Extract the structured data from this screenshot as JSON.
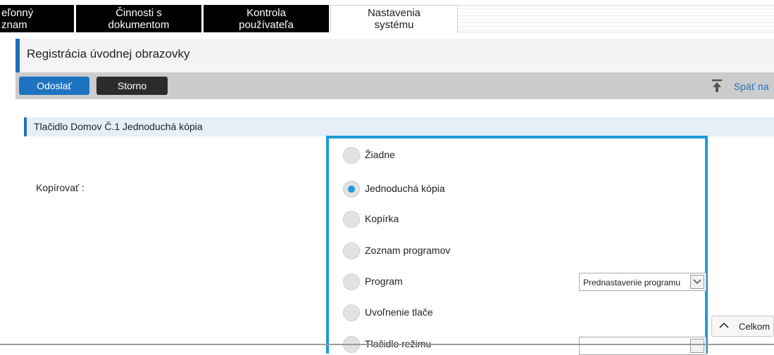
{
  "tabs": [
    {
      "line1": "eľonný",
      "line2": "znam"
    },
    {
      "line1": "Činnosti s",
      "line2": "dokumentom"
    },
    {
      "line1": "Kontrola",
      "line2": "používateľa"
    },
    {
      "line1": "Nastavenia",
      "line2": "systému"
    }
  ],
  "page": {
    "title": "Registrácia úvodnej obrazovky"
  },
  "toolbar": {
    "send_label": "Odoslať",
    "cancel_label": "Storno",
    "back_label": "Späť na"
  },
  "section": {
    "title": "Tlačidlo Domov Č.1 Jednoduchá kópia"
  },
  "form": {
    "copy_label": "Kopírovať :",
    "options": [
      {
        "label": "Žiadne",
        "selected": false
      },
      {
        "label": "Jednoduchá kópia",
        "selected": true
      },
      {
        "label": "Kopírka",
        "selected": false
      },
      {
        "label": "Zoznam programov",
        "selected": false
      },
      {
        "label": "Program",
        "selected": false
      },
      {
        "label": "Uvoľnenie tlače",
        "selected": false
      },
      {
        "label": "Tlačidlo režimu",
        "selected": false
      }
    ],
    "program_select_value": "Prednastavenie programu"
  },
  "collapse": {
    "label": "Celkom"
  },
  "colors": {
    "accent": "#1e73c0",
    "radio_selected": "#1e9ad6",
    "tab_bg": "#000000"
  }
}
